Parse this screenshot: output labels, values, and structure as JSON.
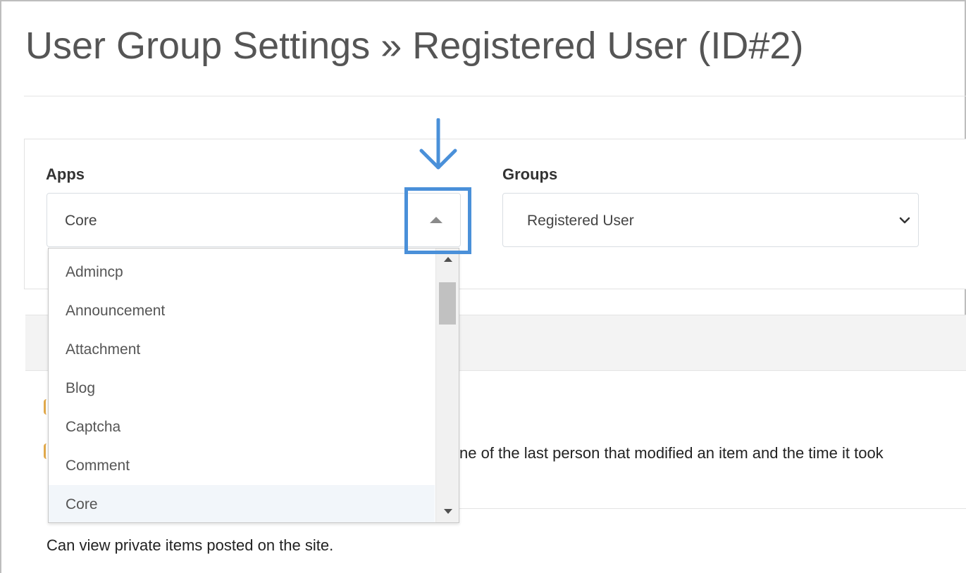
{
  "page": {
    "title": "User Group Settings » Registered User (ID#2)"
  },
  "filters": {
    "apps": {
      "label": "Apps",
      "selected": "Core",
      "options": [
        "Admincp",
        "Announcement",
        "Attachment",
        "Blog",
        "Captcha",
        "Comment",
        "Core"
      ]
    },
    "groups": {
      "label": "Groups",
      "selected": "Registered User"
    }
  },
  "settings": {
    "partial_text_1": "ne of the last person that modified an item and the time it took",
    "text_2": "Can view private items posted on the site."
  },
  "colors": {
    "annotation_blue": "#4a90d9",
    "selected_row": "#f2f6fa"
  },
  "icons": {
    "annotation_arrow": "arrow-down-icon",
    "dropdown_caret": "caret-up-icon",
    "groups_chevron": "chevron-down-icon"
  }
}
